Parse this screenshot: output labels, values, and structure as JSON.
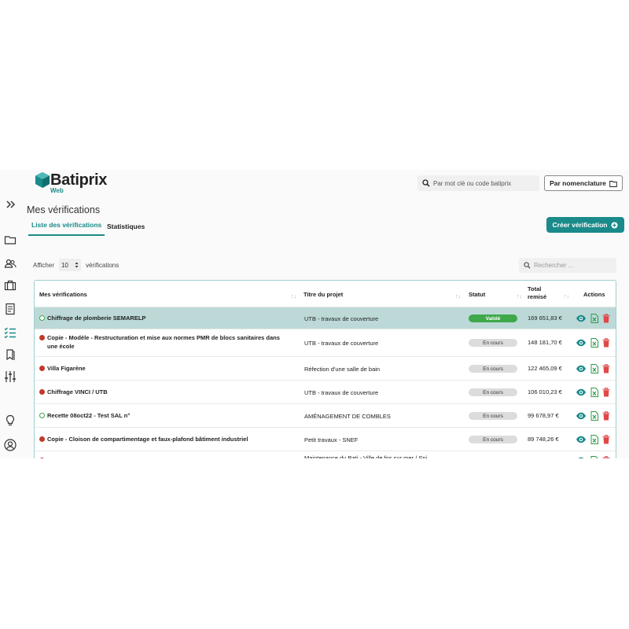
{
  "brand": {
    "name": "Batiprix",
    "sub": "Web"
  },
  "header": {
    "search_placeholder": "Par mot clé ou code batiprix",
    "nomenclature_label": "Par nomenclature"
  },
  "page": {
    "title": "Mes vérifications"
  },
  "tabs": [
    {
      "label": "Liste des vérifications",
      "active": true
    },
    {
      "label": "Statistiques",
      "active": false
    }
  ],
  "create_button": "Créer vérification",
  "list_controls": {
    "show_label": "Afficher",
    "page_size": "10",
    "suffix_label": "vérifications",
    "search_placeholder": "Rechercher ..."
  },
  "table": {
    "headers": [
      "Mes vérifications",
      "Titre du projet",
      "Statut",
      "Total remisé",
      "Actions"
    ],
    "rows": [
      {
        "name": "Chiffrage de plomberie SEMARELP",
        "project": "UTB - travaux de couverture",
        "status": "Validé",
        "total": "169 651,83 €",
        "state": "ok"
      },
      {
        "name": "Copie - Modèle - Restructuration et mise aux normes PMR de blocs sanitaires dans une école",
        "project": "UTB - travaux de couverture",
        "status": "En cours",
        "total": "148 181,70 €",
        "state": "err"
      },
      {
        "name": "Villa Figarène",
        "project": "Réfection d'une salle de bain",
        "status": "En cours",
        "total": "122 465,09 €",
        "state": "err"
      },
      {
        "name": "Chiffrage VINCI / UTB",
        "project": "UTB - travaux de couverture",
        "status": "En cours",
        "total": "106 010,23 €",
        "state": "err"
      },
      {
        "name": "Recette 08oct22 - Test SAL n°",
        "project": "AMÉNAGEMENT DE COMBLES",
        "status": "En cours",
        "total": "99 678,97 €",
        "state": "ok"
      },
      {
        "name": "Copie - Cloison de compartimentage et faux-plafond bâtiment industriel",
        "project": "Petit travaux - SNEF",
        "status": "En cours",
        "total": "89 748,26 €",
        "state": "err"
      },
      {
        "name": "",
        "project": "Maintenance du Bati - Ville de fos sur mer / Spi",
        "status": "",
        "total": "",
        "state": "err"
      }
    ]
  },
  "colors": {
    "accent": "#1a8a8a",
    "selected_row": "#bcd9d8",
    "valid": "#3ea84a",
    "error": "#c0392b",
    "excel": "#2e9a48",
    "delete": "#e04848"
  },
  "icons": [
    "folder-icon",
    "users-icon",
    "briefcase-icon",
    "document-icon",
    "checklist-icon",
    "bookmarks-icon",
    "sliders-icon",
    "lightbulb-icon",
    "user-circle-icon",
    "eye-icon",
    "excel-icon",
    "trash-icon",
    "search-icon",
    "plus-circle-icon"
  ]
}
